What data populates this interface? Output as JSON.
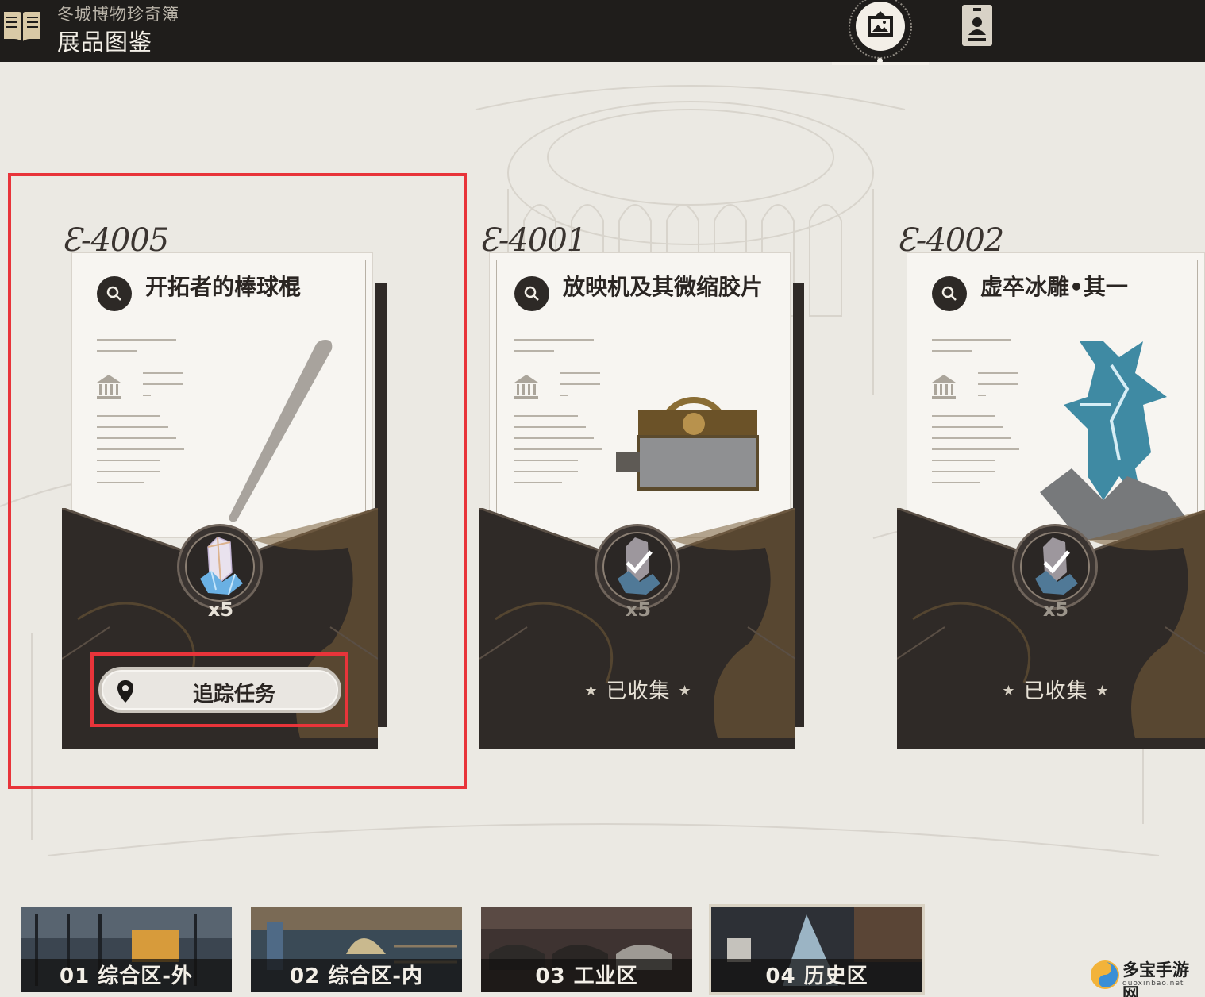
{
  "header": {
    "app_subtitle": "冬城博物珍奇簿",
    "app_title": "展品图鉴",
    "tabs": [
      {
        "icon": "gallery-picture-icon",
        "active": true
      },
      {
        "icon": "id-badge-icon",
        "active": false
      }
    ]
  },
  "exhibits": [
    {
      "code": "Ɛ-4005",
      "name": "开拓者的棒球棍",
      "reward": "x5",
      "state": "uncollected",
      "action_label": "追踪任务",
      "highlighted": true
    },
    {
      "code": "Ɛ-4001",
      "name": "放映机及其微缩胶片",
      "reward": "x5",
      "state": "collected",
      "status_label": "已收集"
    },
    {
      "code": "Ɛ-4002",
      "name": "虚卒冰雕•其一",
      "reward": "x5",
      "state": "collected",
      "status_label": "已收集"
    }
  ],
  "areas": [
    {
      "label": "01 综合区-外",
      "active": false
    },
    {
      "label": "02 综合区-内",
      "active": false
    },
    {
      "label": "03 工业区",
      "active": false
    },
    {
      "label": "04 历史区",
      "active": true
    }
  ],
  "watermark": {
    "text": "多宝手游网",
    "sub": "duoxinbao.net"
  },
  "colors": {
    "topbar": "#1f1d1b",
    "page_bg": "#ebe9e3",
    "paper": "#f7f5f1",
    "envelope": "#2f2a27",
    "envelope_pattern": "#7a5f3a",
    "highlight": "#e8343a"
  }
}
